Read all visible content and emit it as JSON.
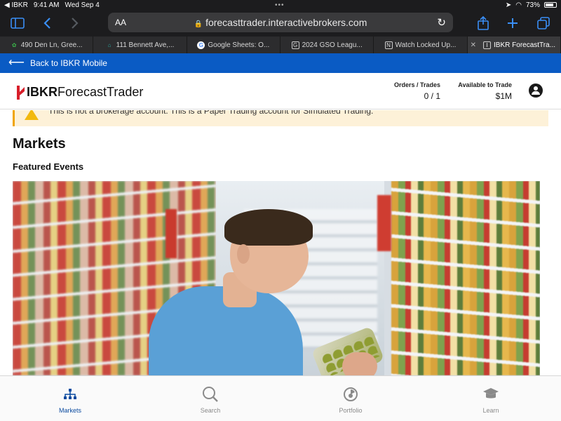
{
  "status_bar": {
    "carrier": "◀ IBKR",
    "time": "9:41 AM",
    "date": "Wed Sep 4",
    "battery": "73%"
  },
  "browser": {
    "text_size_label": "AA",
    "url": "forecasttrader.interactivebrokers.com",
    "tabs": [
      {
        "label": "490 Den Ln, Gree...",
        "icon": "zillow-icon"
      },
      {
        "label": "111 Bennett Ave,...",
        "icon": "house-icon"
      },
      {
        "label": "Google Sheets: O...",
        "icon": "google-icon"
      },
      {
        "label": "2024 GSO Leagu...",
        "icon": "g-box-icon"
      },
      {
        "label": "Watch Locked Up...",
        "icon": "n-box-icon"
      },
      {
        "label": "IBKR ForecastTra...",
        "icon": "i-box-icon",
        "active": true
      }
    ]
  },
  "back_bar": {
    "label": "Back to IBKR Mobile"
  },
  "header": {
    "logo_bold": "IBKR",
    "logo_rest": "ForecastTrader",
    "orders_label": "Orders / Trades",
    "orders_value": "0 / 1",
    "available_label": "Available to Trade",
    "available_value": "$1M"
  },
  "warning": {
    "text": "This is not a brokerage account. This is a Paper Trading account for Simulated Trading."
  },
  "main": {
    "title": "Markets",
    "featured_title": "Featured Events"
  },
  "bottom_nav": [
    {
      "label": "Markets",
      "icon": "markets-hierarchy-icon",
      "active": true
    },
    {
      "label": "Search",
      "icon": "search-icon"
    },
    {
      "label": "Portfolio",
      "icon": "portfolio-icon"
    },
    {
      "label": "Learn",
      "icon": "graduation-cap-icon"
    }
  ],
  "colors": {
    "accent": "#0a5bc4",
    "logo_red": "#d81e2a",
    "warning_bg": "#fdf1d8",
    "active_nav": "#0a4a9f"
  }
}
